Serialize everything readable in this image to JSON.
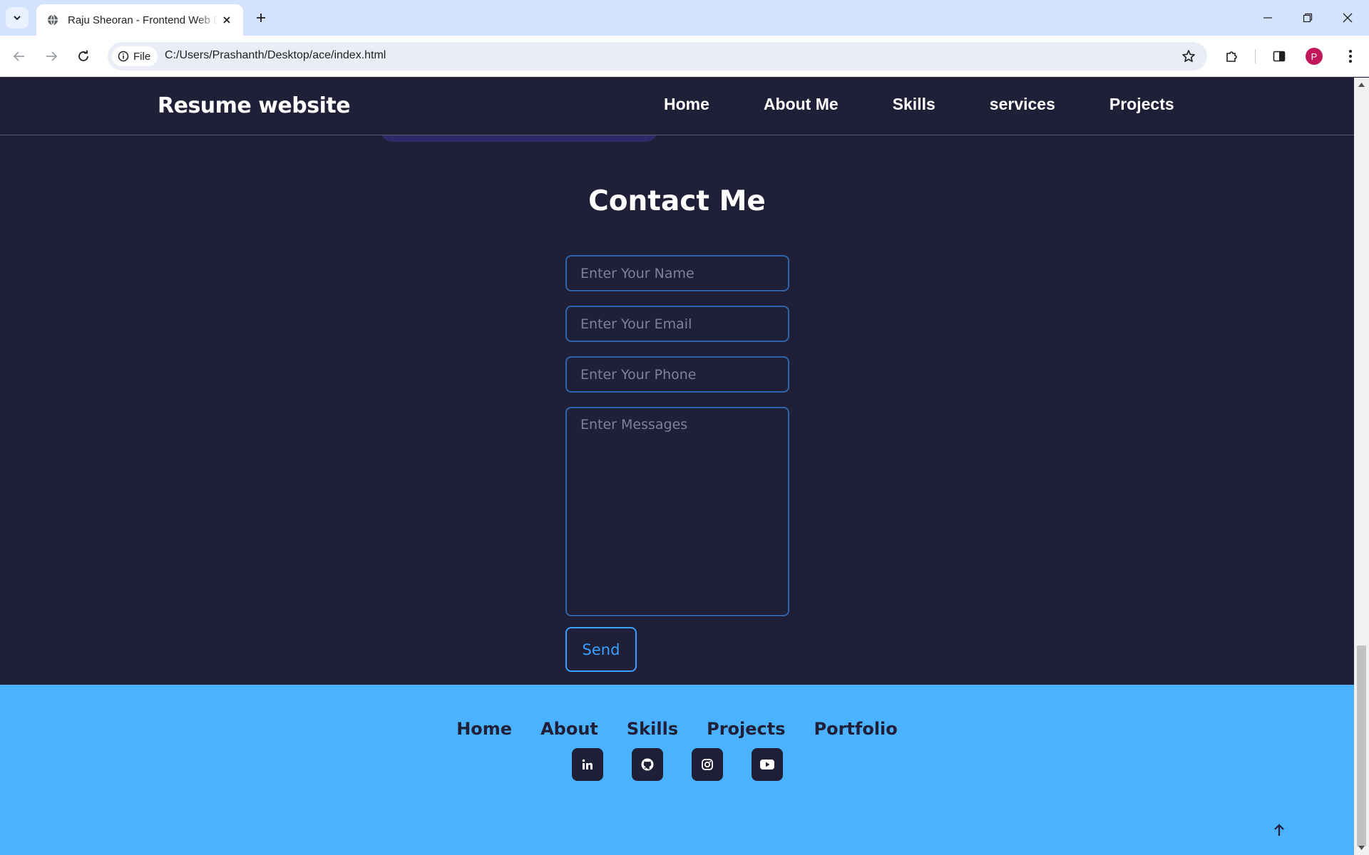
{
  "browser": {
    "tab_title": "Raju Sheoran - Frontend Web Developer",
    "site_chip_label": "File",
    "url": "C:/Users/Prashanth/Desktop/ace/index.html",
    "profile_initial": "P"
  },
  "navbar": {
    "brand": "Resume website",
    "links": [
      "Home",
      "About Me",
      "Skills",
      "services",
      "Projects"
    ]
  },
  "contact": {
    "title": "Contact Me",
    "name_placeholder": "Enter Your Name",
    "email_placeholder": "Enter Your Email",
    "phone_placeholder": "Enter Your Phone",
    "message_placeholder": "Enter Messages",
    "send_label": "Send"
  },
  "footer": {
    "links": [
      "Home",
      "About",
      "Skills",
      "Projects",
      "Portfolio"
    ],
    "socials": [
      "linkedin-icon",
      "github-icon",
      "instagram-icon",
      "youtube-icon"
    ]
  },
  "colors": {
    "page_bg": "#1f1f37",
    "footer_bg": "#4ab2ff",
    "accent": "#3aa0ff",
    "field_border": "#2f65a8"
  }
}
